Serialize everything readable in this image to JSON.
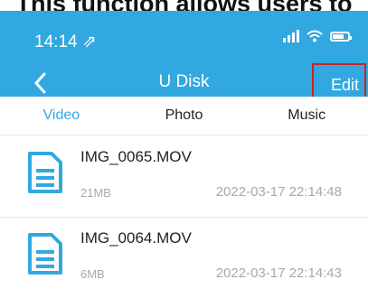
{
  "caption": "This function allows users to",
  "status_bar": {
    "time": "14:14 ⇗"
  },
  "header": {
    "title": "U Disk",
    "edit_label": "Edit"
  },
  "tabs": [
    {
      "label": "Video",
      "active": true
    },
    {
      "label": "Photo",
      "active": false
    },
    {
      "label": "Music",
      "active": false
    }
  ],
  "files": [
    {
      "name": "IMG_0065.MOV",
      "size": "21MB",
      "date": "2022-03-17 22:14:48"
    },
    {
      "name": "IMG_0064.MOV",
      "size": "6MB",
      "date": "2022-03-17 22:14:43"
    }
  ],
  "colors": {
    "accent": "#31a8e0",
    "highlight_box": "#d02020"
  },
  "icons": {
    "back": "chevron-left-icon",
    "file": "document-icon",
    "wifi": "wifi-icon",
    "battery": "battery-icon",
    "signal": "signal-icon"
  }
}
